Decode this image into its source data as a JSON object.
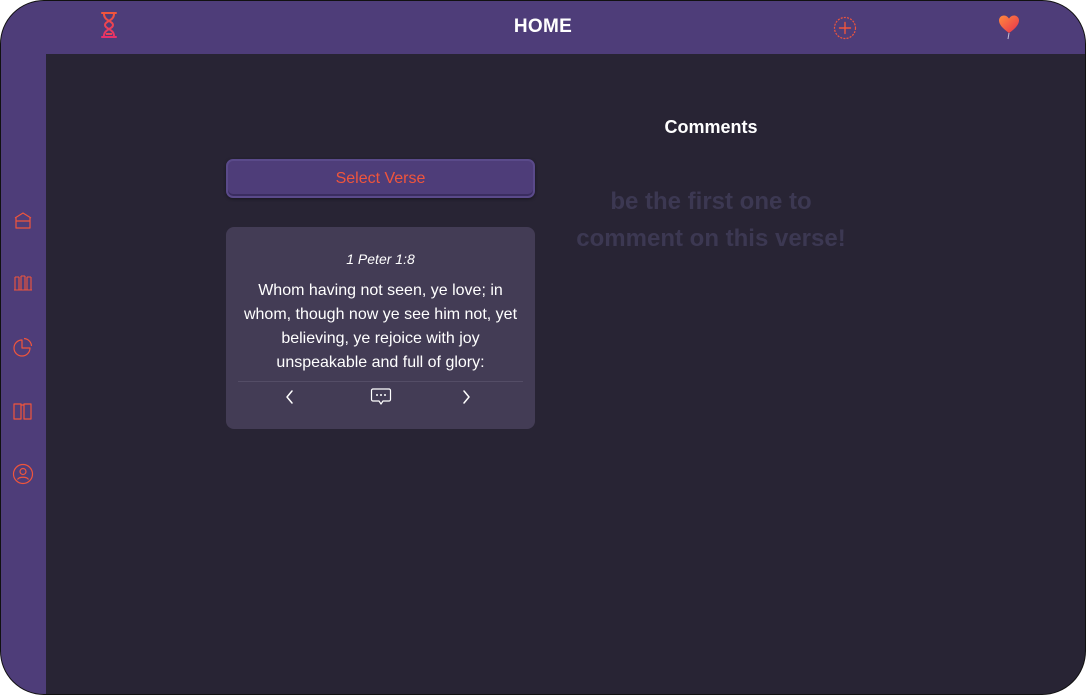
{
  "header": {
    "title": "HOME",
    "left_icon": "hourglass-icon",
    "add_icon": "plus-circle-icon",
    "heart_icon": "heart-balloon-icon"
  },
  "sidebar": {
    "items": [
      {
        "icon": "church-icon"
      },
      {
        "icon": "library-icon"
      },
      {
        "icon": "pie-chart-icon"
      },
      {
        "icon": "book-icon"
      },
      {
        "icon": "user-circle-icon"
      }
    ]
  },
  "verse_panel": {
    "select_label": "Select Verse",
    "reference": "1 Peter 1:8",
    "text": "Whom having not seen, ye love; in whom, though now ye see him not, yet believing, ye rejoice with joy unspeakable and full of glory:",
    "prev_icon": "chevron-left-icon",
    "comment_icon": "comment-bubble-icon",
    "next_icon": "chevron-right-icon"
  },
  "comments": {
    "title": "Comments",
    "empty_message": "be the first one to comment on this verse!"
  },
  "colors": {
    "bar": "#4e3d79",
    "background": "#282434",
    "card": "#433c55",
    "accent": "#f0553c"
  }
}
